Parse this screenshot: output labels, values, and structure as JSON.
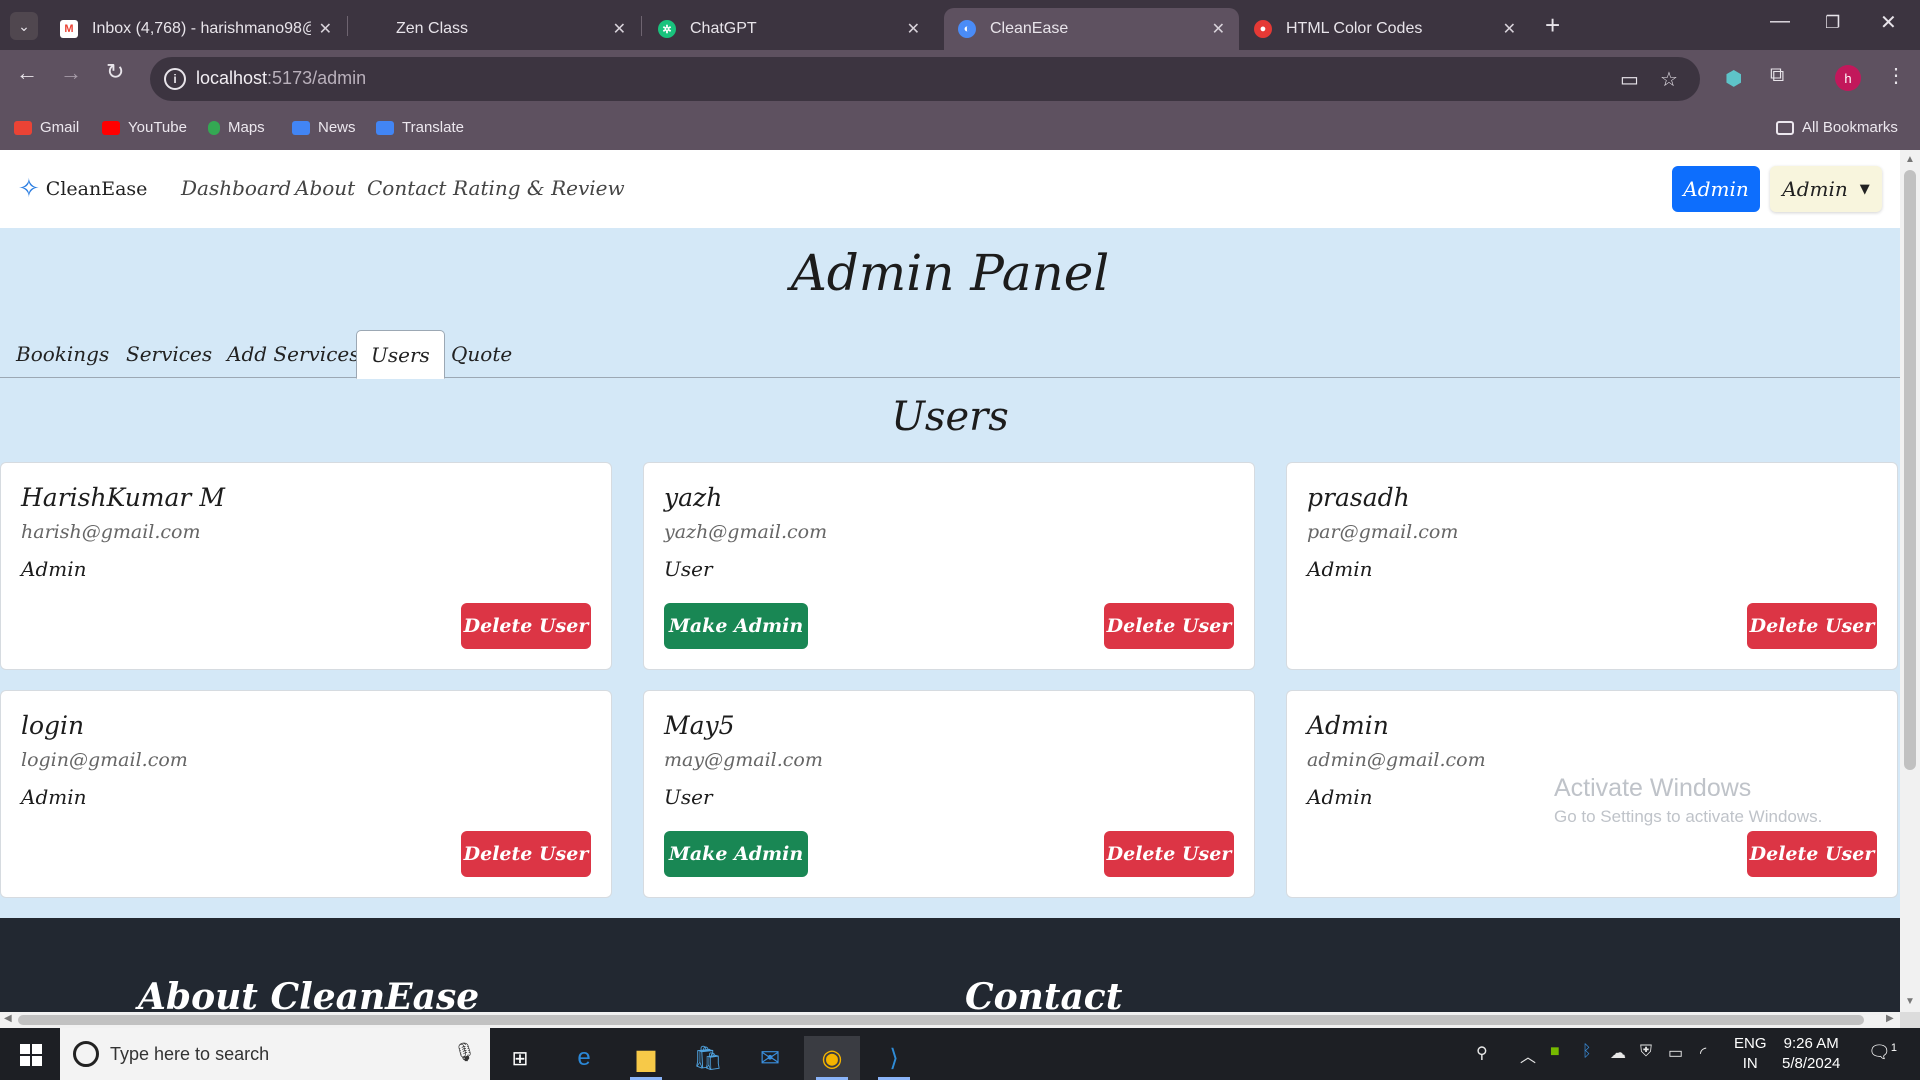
{
  "browser": {
    "tabs": [
      {
        "title": "Inbox (4,768) - harishmano98@",
        "close": "✕"
      },
      {
        "title": "Zen Class",
        "close": "✕"
      },
      {
        "title": "ChatGPT",
        "close": "✕"
      },
      {
        "title": "CleanEase",
        "close": "✕"
      },
      {
        "title": "HTML Color Codes",
        "close": "✕"
      }
    ],
    "new_tab": "+",
    "url_host": "localhost",
    "url_path": ":5173/admin",
    "profile_initial": "h",
    "bookmarks": [
      "Gmail",
      "YouTube",
      "Maps",
      "News",
      "Translate"
    ],
    "all_bookmarks": "All Bookmarks"
  },
  "site": {
    "brand": "CleanEase",
    "nav": [
      "Dashboard",
      "About",
      "Contact",
      "Rating & Review"
    ],
    "admin_button": "Admin",
    "admin_dropdown": "Admin"
  },
  "panel": {
    "title": "Admin Panel",
    "tabs": [
      "Bookings",
      "Services",
      "Add Services",
      "Users",
      "Quote"
    ],
    "active_tab": "Users",
    "section_title": "Users"
  },
  "users": [
    {
      "name": "HarishKumar M",
      "email": "harish@gmail.com",
      "role": "Admin"
    },
    {
      "name": "yazh",
      "email": "yazh@gmail.com",
      "role": "User"
    },
    {
      "name": "prasadh",
      "email": "par@gmail.com",
      "role": "Admin"
    },
    {
      "name": "login",
      "email": "login@gmail.com",
      "role": "Admin"
    },
    {
      "name": "May5",
      "email": "may@gmail.com",
      "role": "User"
    },
    {
      "name": "Admin",
      "email": "admin@gmail.com",
      "role": "Admin"
    }
  ],
  "buttons": {
    "delete": "Delete User",
    "make_admin": "Make Admin"
  },
  "footer": {
    "about_heading": "About CleanEase",
    "contact_heading": "Contact"
  },
  "activation": {
    "line1": "Activate Windows",
    "line2": "Go to Settings to activate Windows."
  },
  "taskbar": {
    "search_placeholder": "Type here to search",
    "lang1": "ENG",
    "lang2": "IN",
    "time": "9:26 AM",
    "date": "5/8/2024",
    "notifications": "1"
  },
  "colors": {
    "primary": "#0d6efd",
    "danger": "#dc3545",
    "success": "#198754",
    "page_bg": "#d4e8f7",
    "footer_bg": "#222831"
  }
}
